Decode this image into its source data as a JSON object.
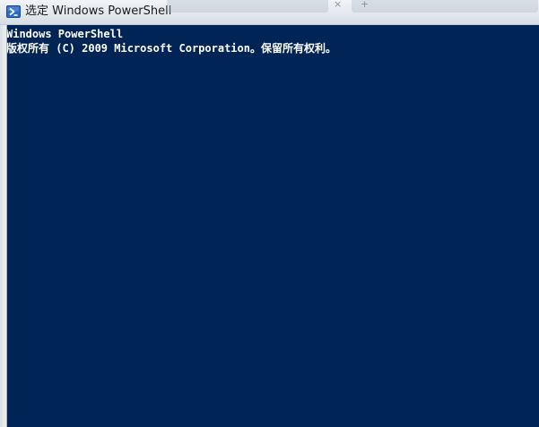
{
  "window": {
    "title": "选定 Windows PowerShell",
    "icon": "powershell-icon",
    "background_color": "#012456",
    "text_color": "#ffffff"
  },
  "console": {
    "lines": [
      "Windows PowerShell",
      "版权所有 (C) 2009 Microsoft Corporation。保留所有权利。"
    ]
  },
  "background_window": {
    "glyphs": [
      "×",
      "+"
    ]
  }
}
